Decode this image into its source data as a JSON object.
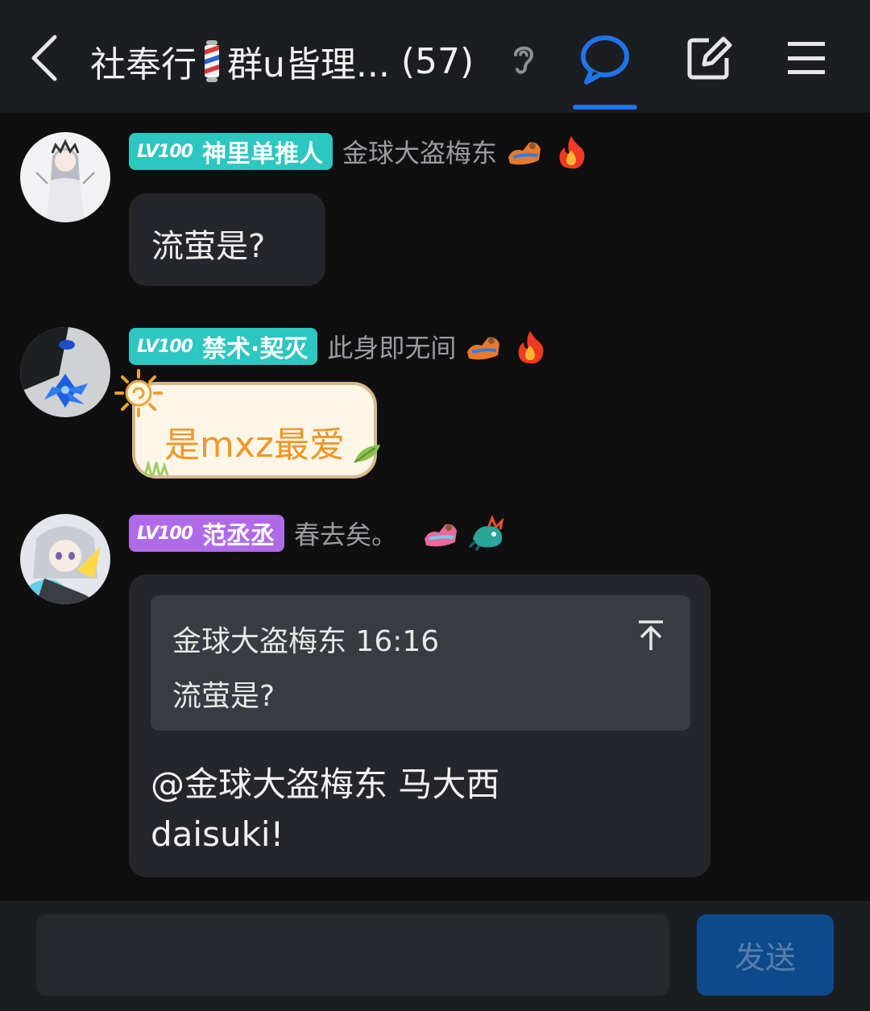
{
  "header": {
    "title_left": "社奉行",
    "title_right": "群u皆理...",
    "member_count": "(57)",
    "accent_color": "#1f74e8"
  },
  "messages": [
    {
      "level": "LV100",
      "badge_name": "神里单推人",
      "nickname": "金球大盗梅东",
      "text": "流萤是?"
    },
    {
      "level": "LV100",
      "badge_name": "禁术·契灭",
      "nickname": "此身即无间",
      "text": "是mxz最爱"
    },
    {
      "level": "LV100",
      "badge_name": "范丞丞",
      "nickname": "春去矣。",
      "quote": {
        "header": "金球大盗梅东 16:16",
        "text": "流萤是?"
      },
      "reply_line1": "@金球大盗梅东 马大西",
      "reply_line2": "daisuki!"
    }
  ],
  "input": {
    "placeholder": "",
    "send_label": "发送"
  },
  "icons": [
    "back-icon",
    "barber-pole-emoji",
    "ear-icon",
    "chat-bubble-icon",
    "edit-icon",
    "menu-icon",
    "jump-to-original-icon"
  ]
}
